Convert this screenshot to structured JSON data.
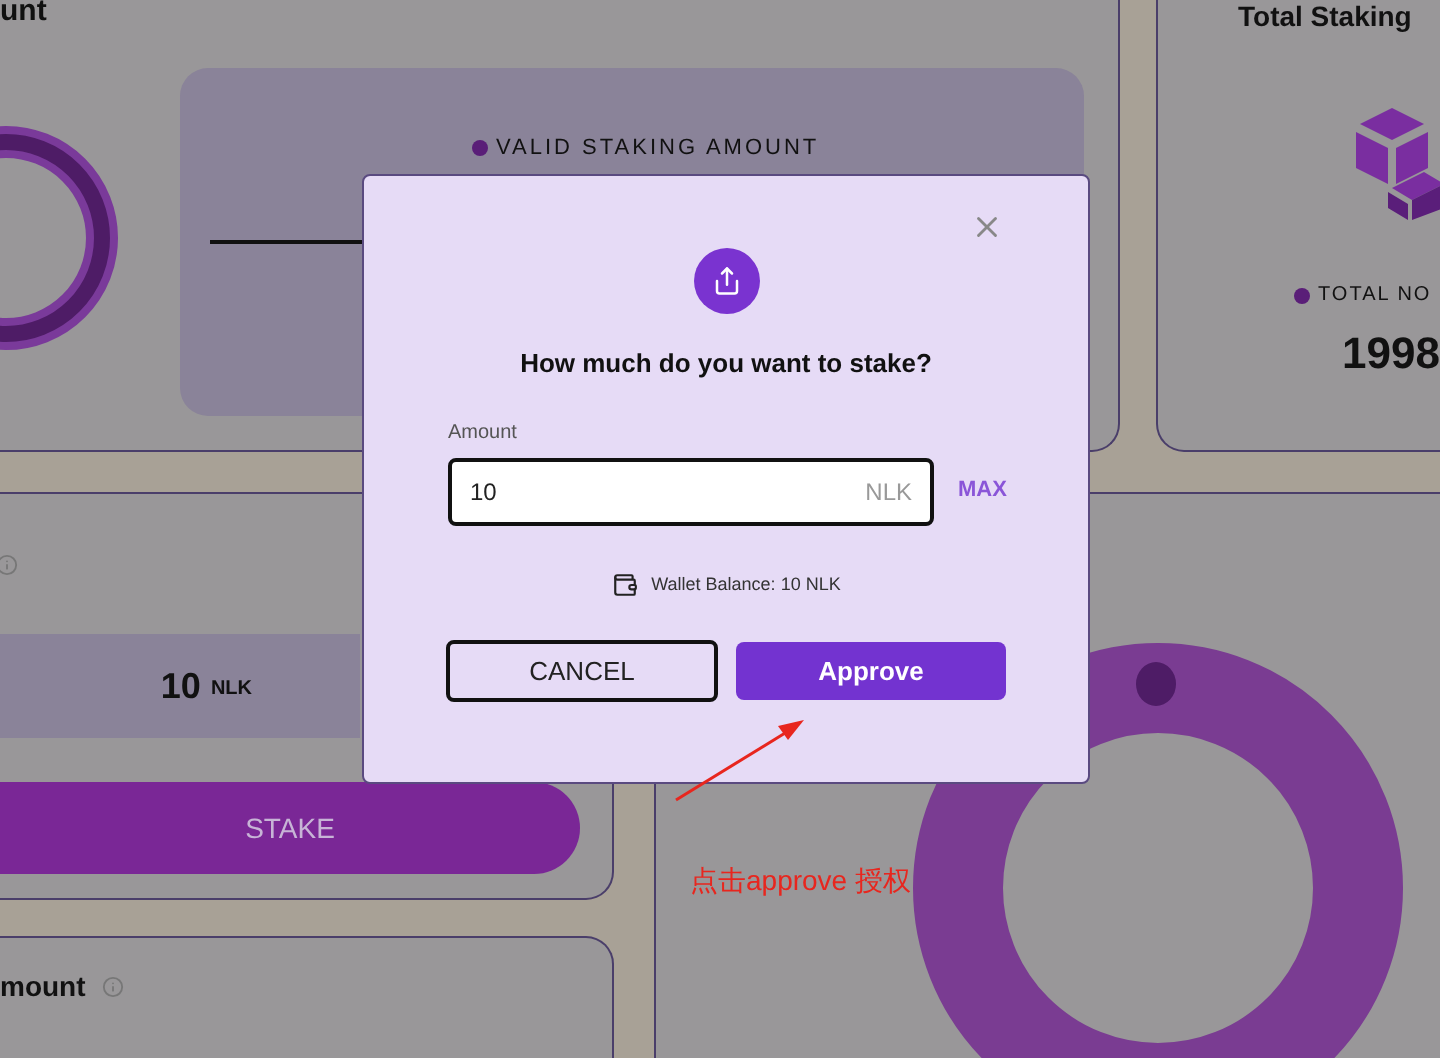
{
  "background": {
    "top_left_card": {
      "heading": "unt",
      "legend": "VALID STAKING AMOUNT"
    },
    "top_right_card": {
      "heading": "Total Staking",
      "legend": "TOTAL NO",
      "value": "1998"
    },
    "stake_card": {
      "amount": "10",
      "unit": "NLK",
      "button": "STAKE"
    },
    "bottom_card": {
      "heading": "mount"
    }
  },
  "dialog": {
    "title": "How much do you want to stake?",
    "amount_label": "Amount",
    "amount_value": "10",
    "unit": "NLK",
    "max": "MAX",
    "wallet_label": "Wallet Balance:",
    "wallet_value": "10",
    "wallet_unit": "NLK",
    "cancel": "CANCEL",
    "approve": "Approve"
  },
  "annotation": {
    "text": "点击approve 授权"
  }
}
